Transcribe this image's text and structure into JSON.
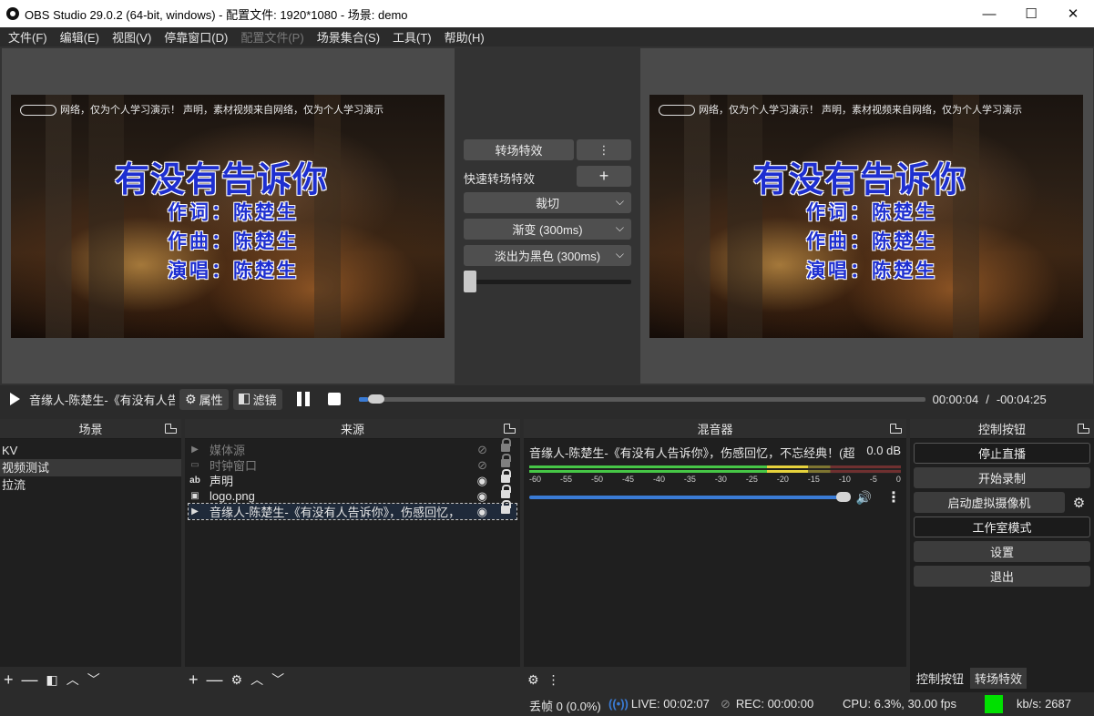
{
  "window": {
    "title": "OBS Studio 29.0.2 (64-bit, windows) - 配置文件: 1920*1080 - 场景: demo",
    "minimize": "—",
    "maximize": "☐",
    "close": "✕"
  },
  "menu": [
    "文件(F)",
    "编辑(E)",
    "视图(V)",
    "停靠窗口(D)",
    "配置文件(P)",
    "场景集合(S)",
    "工具(T)",
    "帮助(H)"
  ],
  "preview": {
    "watermark": "声明，素材视频来自网络，仅为个人学习演示！",
    "watermark_left": "网络，仅为个人学习演示！  声明，素材视频来自网络，仅为个人学习演示",
    "headline": "有没有告诉你",
    "lyricist": "作词：陈楚生",
    "composer": "作曲：陈楚生",
    "singer": "演唱：陈楚生"
  },
  "transitions": {
    "transition_button": "转场特效",
    "menu_dots": "⋮",
    "quick_label": "快速转场特效",
    "add": "+",
    "options": [
      "裁切",
      "渐变 (300ms)",
      "淡出为黑色 (300ms)"
    ],
    "tbar_position": 0
  },
  "media": {
    "title": "音缘人-陈楚生-《有没有人告诉你》",
    "properties": "属性",
    "filters": "滤镜",
    "elapsed": "00:00:04",
    "separator": "/",
    "remaining": "-00:04:25",
    "progress": 0.016
  },
  "scenes": {
    "header": "场景",
    "items": [
      "KV",
      "视频测试",
      "拉流"
    ],
    "selected_index": 1
  },
  "sources": {
    "header": "来源",
    "items": [
      {
        "name": "媒体源",
        "icon": "▶",
        "visible": false
      },
      {
        "name": "时钟窗口",
        "icon": "▭",
        "visible": false
      },
      {
        "name": "声明",
        "icon": "ab",
        "visible": true
      },
      {
        "name": "logo.png",
        "icon": "▣",
        "visible": true
      },
      {
        "name": "音缘人-陈楚生-《有没有人告诉你》，伤感回忆，",
        "icon": "▶",
        "visible": true
      }
    ]
  },
  "mixer": {
    "header": "混音器",
    "track_name": "音缘人-陈楚生-《有没有人告诉你》，伤感回忆，不忘经典！(超",
    "level": "0.0 dB",
    "scale": [
      "-60",
      "-55",
      "-50",
      "-45",
      "-40",
      "-35",
      "-30",
      "-25",
      "-20",
      "-15",
      "-10",
      "-5",
      "0"
    ],
    "meter_level_1": 0.75,
    "meter_level_2": 0.82,
    "volume": 1.0
  },
  "controls": {
    "header": "控制按钮",
    "stop_stream": "停止直播",
    "start_record": "开始录制",
    "virtual_cam": "启动虚拟摄像机",
    "studio_mode": "工作室模式",
    "settings": "设置",
    "exit": "退出",
    "tab_controls": "控制按钮",
    "tab_transitions": "转场特效"
  },
  "status": {
    "dropped": "丢帧 0 (0.0%)",
    "live": "LIVE: 00:02:07",
    "rec": "REC: 00:00:00",
    "cpu": "CPU: 6.3%, 30.00 fps",
    "kbps": "kb/s: 2687",
    "health_color": "#00e000"
  }
}
